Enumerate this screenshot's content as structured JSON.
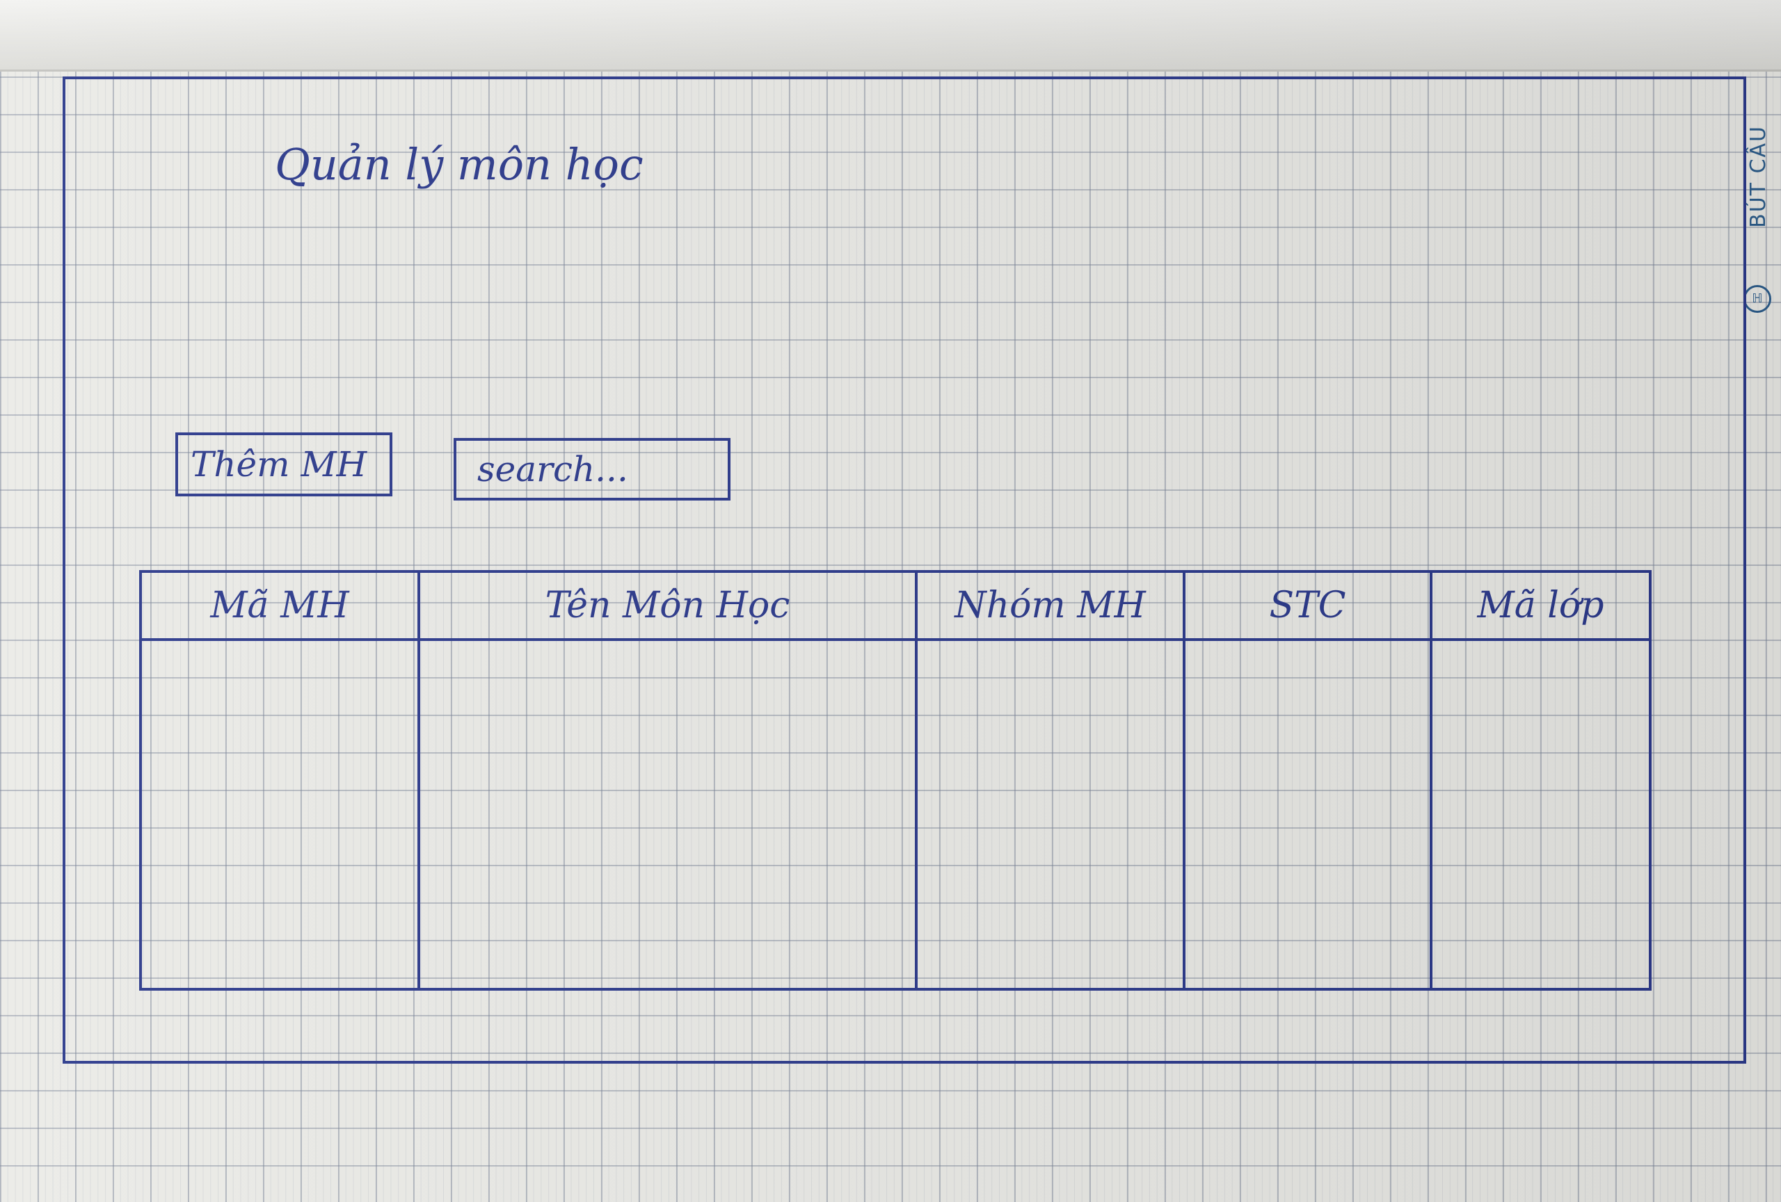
{
  "page": {
    "title": "Quản lý môn học"
  },
  "toolbar": {
    "add_label": "Thêm MH",
    "search_placeholder": "search..."
  },
  "table": {
    "columns": [
      "Mã MH",
      "Tên Môn Học",
      "Nhóm MH",
      "STC",
      "Mã lớp"
    ],
    "rows": []
  },
  "notebook": {
    "brand": "BÚT CÂU",
    "ink_color": "#2c3a8c"
  }
}
